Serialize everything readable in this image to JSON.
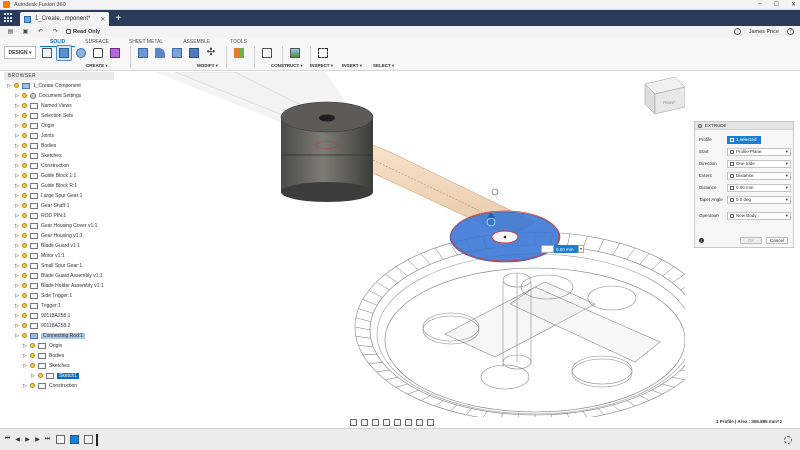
{
  "window": {
    "title": "Autodesk Fusion 360",
    "controls": [
      "–",
      "☐",
      "✕"
    ]
  },
  "document_tab": {
    "label": "1_Create...mponent*",
    "close": "✕",
    "add": "+"
  },
  "qat": {
    "readonly_label": "Read Only",
    "user": "James Price",
    "help": "?"
  },
  "ribbon": {
    "workspace": "DESIGN ▾",
    "tabs": [
      "SOLID",
      "SURFACE",
      "SHEET METAL",
      "ASSEMBLE",
      "TOOLS"
    ],
    "groups": [
      "CREATE ▾",
      "MODIFY ▾",
      "CONSTRUCT ▾",
      "INSPECT ▾",
      "INSERT ▾",
      "SELECT ▾"
    ]
  },
  "browser": {
    "title": "BROWSER",
    "items": [
      {
        "label": "1_Create Component",
        "indent": 0,
        "icon": "comp"
      },
      {
        "label": "Document Settings",
        "indent": 1,
        "icon": "gear"
      },
      {
        "label": "Named Views",
        "indent": 1,
        "icon": "folder"
      },
      {
        "label": "Selection Sets",
        "indent": 1,
        "icon": "folder"
      },
      {
        "label": "Origin",
        "indent": 1,
        "icon": "folder"
      },
      {
        "label": "Joints",
        "indent": 1,
        "icon": "folder"
      },
      {
        "label": "Bodies",
        "indent": 1,
        "icon": "folder"
      },
      {
        "label": "Sketches",
        "indent": 1,
        "icon": "folder"
      },
      {
        "label": "Construction",
        "indent": 1,
        "icon": "folder"
      },
      {
        "label": "Guide Block 1:1",
        "indent": 1,
        "icon": "folder"
      },
      {
        "label": "Guide Block R:1",
        "indent": 1,
        "icon": "folder"
      },
      {
        "label": "Large Spur Gear:1",
        "indent": 1,
        "icon": "folder"
      },
      {
        "label": "Gear Shaft:1",
        "indent": 1,
        "icon": "folder"
      },
      {
        "label": "ROD PIN:1",
        "indent": 1,
        "icon": "folder"
      },
      {
        "label": "Gear Housing Cover v1:1",
        "indent": 1,
        "icon": "folder"
      },
      {
        "label": "Gear Housing v1:1",
        "indent": 1,
        "icon": "folder"
      },
      {
        "label": "Blade Guard v1:1",
        "indent": 1,
        "icon": "folder"
      },
      {
        "label": "Motor v1:1",
        "indent": 1,
        "icon": "folder"
      },
      {
        "label": "Small Spur Gear:1",
        "indent": 1,
        "icon": "folder"
      },
      {
        "label": "Blade Guard Assembly v1:1",
        "indent": 1,
        "icon": "folder"
      },
      {
        "label": "Blade Holder Assembly v1:1",
        "indent": 1,
        "icon": "folder"
      },
      {
        "label": "Side Trigger:1",
        "indent": 1,
        "icon": "folder"
      },
      {
        "label": "Trigger:1",
        "indent": 1,
        "icon": "folder"
      },
      {
        "label": "90118A258:1",
        "indent": 1,
        "icon": "folder"
      },
      {
        "label": "90118A258:2",
        "indent": 1,
        "icon": "folder"
      },
      {
        "label": "Connecting Rod:1",
        "indent": 1,
        "icon": "comp",
        "state": "comp"
      },
      {
        "label": "Origin",
        "indent": 2,
        "icon": "folder"
      },
      {
        "label": "Bodies",
        "indent": 2,
        "icon": "folder"
      },
      {
        "label": "Sketches",
        "indent": 2,
        "icon": "folder"
      },
      {
        "label": "Sketch1",
        "indent": 3,
        "icon": "sketch",
        "state": "hl"
      },
      {
        "label": "Construction",
        "indent": 2,
        "icon": "folder"
      }
    ]
  },
  "extrude": {
    "title": "EXTRUDE",
    "rows": [
      {
        "key": "Profile",
        "value": "1 selected",
        "selected": true
      },
      {
        "key": "Start",
        "value": "Profile Plane"
      },
      {
        "key": "Direction",
        "value": "One Side"
      },
      {
        "key": "Extent",
        "value": "Distance"
      },
      {
        "key": "Distance",
        "value": "0.00 mm"
      },
      {
        "key": "Taper Angle",
        "value": "0.0 deg"
      },
      {
        "key": "Operation",
        "value": "New Body"
      }
    ],
    "ok": "OK",
    "cancel": "Cancel",
    "info": "i"
  },
  "viewport": {
    "dim_value": "0.00 mm"
  },
  "viewcube": {
    "label": "FRONT"
  },
  "status": {
    "info": "1 Profile | Area : 355.885 mm^2"
  },
  "colors": {
    "accent": "#1b7fd1",
    "titlebar": "#2a3a5a",
    "profile": "#3b78d6"
  }
}
